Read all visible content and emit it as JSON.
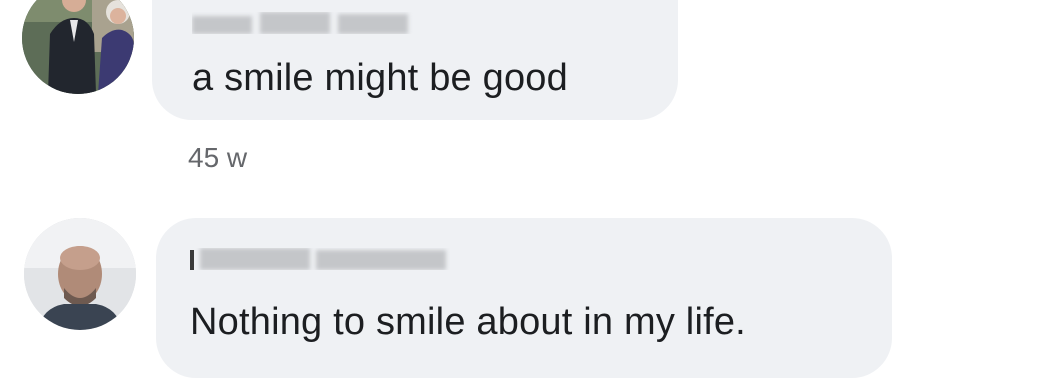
{
  "comments": [
    {
      "text": "a smile might be good",
      "timestamp": "45 w"
    },
    {
      "text": "Nothing to smile about in my life."
    }
  ],
  "colors": {
    "bubble": "#eff1f4",
    "text": "#1c1e21",
    "meta": "#65676b",
    "redaction": "#c4c6c9"
  },
  "icons": {
    "avatar_1": "profile-photo-couple",
    "avatar_2": "profile-photo-man"
  }
}
